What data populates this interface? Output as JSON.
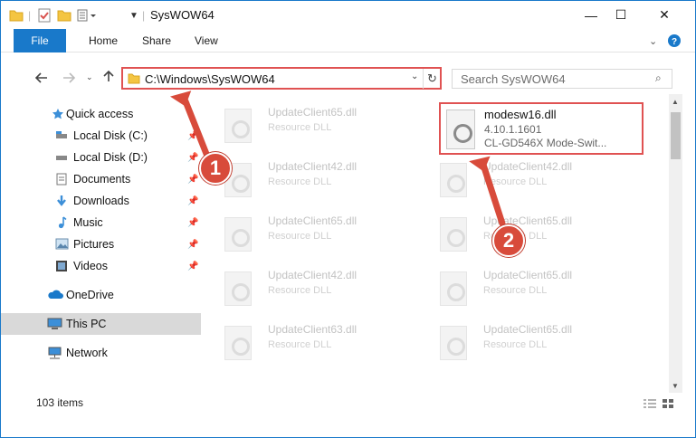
{
  "window": {
    "title": "SysWOW64",
    "minimize": "—",
    "maximize": "☐",
    "close": "✕"
  },
  "ribbon": {
    "tabs": [
      "File",
      "Home",
      "Share",
      "View"
    ]
  },
  "navigation": {
    "address": "C:\\Windows\\SysWOW64",
    "search_placeholder": "Search SysWOW64"
  },
  "sidebar": {
    "items": [
      {
        "label": "Quick access",
        "icon": "star-icon",
        "pinned": false
      },
      {
        "label": "Local Disk (C:)",
        "icon": "drive-icon",
        "pinned": true
      },
      {
        "label": "Local Disk (D:)",
        "icon": "drive-icon",
        "pinned": true
      },
      {
        "label": "Documents",
        "icon": "documents-icon",
        "pinned": true
      },
      {
        "label": "Downloads",
        "icon": "download-icon",
        "pinned": true
      },
      {
        "label": "Music",
        "icon": "music-icon",
        "pinned": true
      },
      {
        "label": "Pictures",
        "icon": "pictures-icon",
        "pinned": true
      },
      {
        "label": "Videos",
        "icon": "videos-icon",
        "pinned": true
      },
      {
        "label": "OneDrive",
        "icon": "cloud-icon",
        "pinned": false
      },
      {
        "label": "This PC",
        "icon": "computer-icon",
        "pinned": false
      },
      {
        "label": "Network",
        "icon": "network-icon",
        "pinned": false
      }
    ]
  },
  "files": {
    "left_column": [
      {
        "name": "UpdateClient65.dll",
        "desc": "Resource DLL"
      },
      {
        "name": "UpdateClient42.dll",
        "desc": "Resource DLL"
      },
      {
        "name": "UpdateClient65.dll",
        "desc": "Resource DLL"
      },
      {
        "name": "UpdateClient42.dll",
        "desc": "Resource DLL"
      },
      {
        "name": "UpdateClient63.dll",
        "desc": "Resource DLL"
      }
    ],
    "right_column": [
      {
        "name": "UpdateClient42.dll",
        "desc": "Resource DLL"
      },
      {
        "name": "UpdateClient65.dll",
        "desc": "Resource DLL"
      },
      {
        "name": "UpdateClient65.dll",
        "desc": "Resource DLL"
      },
      {
        "name": "UpdateClient65.dll",
        "desc": "Resource DLL"
      }
    ],
    "highlighted": {
      "name": "modesw16.dll",
      "version": "4.10.1.1601",
      "description": "CL-GD546X Mode-Swit..."
    }
  },
  "status": {
    "item_count": "103 items"
  },
  "annotations": [
    "1",
    "2"
  ],
  "colors": {
    "accent": "#1979ca",
    "highlight": "#e05252"
  }
}
